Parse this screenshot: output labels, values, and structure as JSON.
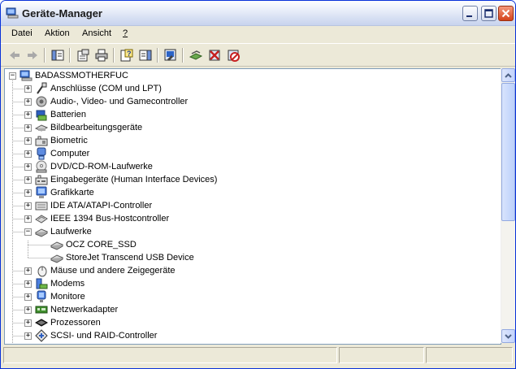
{
  "window": {
    "title": "Geräte-Manager"
  },
  "menu": {
    "datei": "Datei",
    "aktion": "Aktion",
    "ansicht": "Ansicht",
    "help": "?"
  },
  "toolbar_icons": [
    "back-icon",
    "forward-icon",
    "show-hide-tree-icon",
    "properties-icon",
    "print-icon",
    "help-icon",
    "action-view-icon",
    "scan-hardware-icon",
    "update-driver-icon",
    "uninstall-icon",
    "disable-icon"
  ],
  "tree": {
    "root": "BADASSMOTHERFUC",
    "items": [
      {
        "label": "Anschlüsse (COM und LPT)",
        "icon": "port-icon",
        "expanded": false
      },
      {
        "label": "Audio-, Video- und Gamecontroller",
        "icon": "audio-icon",
        "expanded": false
      },
      {
        "label": "Batterien",
        "icon": "battery-icon",
        "expanded": false
      },
      {
        "label": "Bildbearbeitungsgeräte",
        "icon": "imaging-icon",
        "expanded": false
      },
      {
        "label": "Biometric",
        "icon": "biometric-icon",
        "expanded": false
      },
      {
        "label": "Computer",
        "icon": "computer-icon",
        "expanded": false
      },
      {
        "label": "DVD/CD-ROM-Laufwerke",
        "icon": "cdrom-icon",
        "expanded": false
      },
      {
        "label": "Eingabegeräte (Human Interface Devices)",
        "icon": "hid-icon",
        "expanded": false
      },
      {
        "label": "Grafikkarte",
        "icon": "display-adapter-icon",
        "expanded": false
      },
      {
        "label": "IDE ATA/ATAPI-Controller",
        "icon": "ide-icon",
        "expanded": false
      },
      {
        "label": "IEEE 1394 Bus-Hostcontroller",
        "icon": "firewire-icon",
        "expanded": false
      },
      {
        "label": "Laufwerke",
        "icon": "disk-drive-icon",
        "expanded": true
      },
      {
        "label": "OCZ CORE_SSD",
        "icon": "disk-drive-icon",
        "child": true
      },
      {
        "label": "StoreJet  Transcend USB Device",
        "icon": "disk-drive-icon",
        "child": true
      },
      {
        "label": "Mäuse und andere Zeigegeräte",
        "icon": "mouse-icon",
        "expanded": false
      },
      {
        "label": "Modems",
        "icon": "modem-icon",
        "expanded": false
      },
      {
        "label": "Monitore",
        "icon": "monitor-icon",
        "expanded": false
      },
      {
        "label": "Netzwerkadapter",
        "icon": "network-adapter-icon",
        "expanded": false
      },
      {
        "label": "Prozessoren",
        "icon": "processor-icon",
        "expanded": false
      },
      {
        "label": "SCSI- und RAID-Controller",
        "icon": "scsi-icon",
        "expanded": false
      }
    ]
  }
}
